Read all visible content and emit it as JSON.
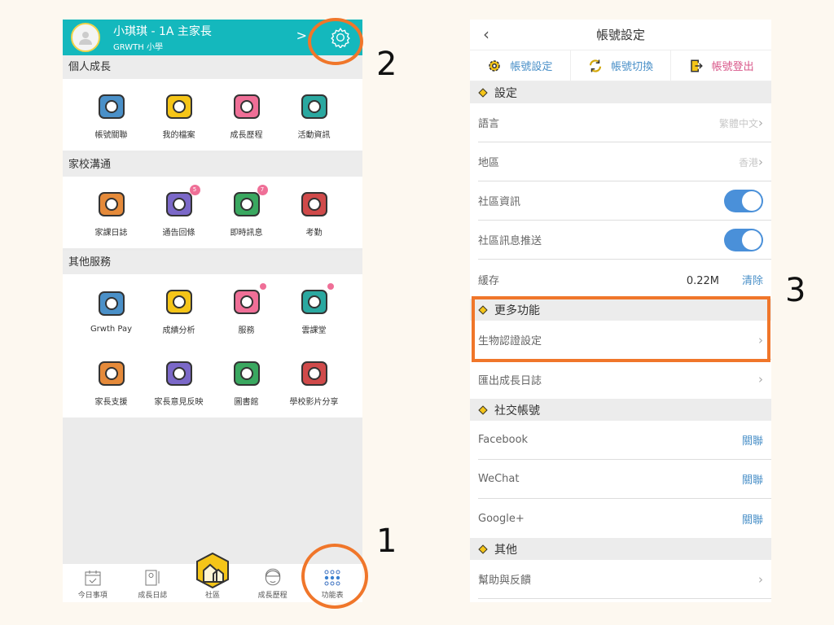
{
  "left": {
    "header": {
      "name": "小琪琪 - 1A  主家長",
      "school": "GRWTH 小學"
    },
    "sections": [
      {
        "title": "個人成長",
        "items": [
          {
            "label": "帳號關聯"
          },
          {
            "label": "我的檔案"
          },
          {
            "label": "成長歷程"
          },
          {
            "label": "活動資訊"
          }
        ]
      },
      {
        "title": "家校溝通",
        "items": [
          {
            "label": "家課日誌"
          },
          {
            "label": "通告回條",
            "badge": "5"
          },
          {
            "label": "即時訊息",
            "badge": "7"
          },
          {
            "label": "考勤"
          }
        ]
      },
      {
        "title": "其他服務",
        "items": [
          {
            "label": "Grwth Pay"
          },
          {
            "label": "成績分析"
          },
          {
            "label": "服務"
          },
          {
            "label": "雲課堂"
          },
          {
            "label": "家長支援"
          },
          {
            "label": "家長意見反映"
          },
          {
            "label": "圖書館"
          },
          {
            "label": "學校影片分享"
          }
        ]
      }
    ],
    "nav": [
      {
        "label": "今日事項"
      },
      {
        "label": "成長日誌"
      },
      {
        "label": "社區"
      },
      {
        "label": "成長歷程"
      },
      {
        "label": "功能表"
      }
    ]
  },
  "right": {
    "title": "帳號設定",
    "tabs": [
      {
        "label": "帳號設定",
        "color": "#4a90c8"
      },
      {
        "label": "帳號切換",
        "color": "#4a90c8"
      },
      {
        "label": "帳號登出",
        "color": "#d9588a"
      }
    ],
    "settings_header": "設定",
    "language": {
      "label": "語言",
      "value": "繁體中文"
    },
    "region": {
      "label": "地區",
      "value": "香港"
    },
    "community_info": {
      "label": "社區資訊",
      "on": true
    },
    "community_push": {
      "label": "社區訊息推送",
      "on": true
    },
    "cache": {
      "label": "緩存",
      "value": "0.22M",
      "action": "清除"
    },
    "more_header": "更多功能",
    "biometric": {
      "label": "生物認證設定"
    },
    "export": {
      "label": "匯出成長日誌"
    },
    "social_header": "社交帳號",
    "social": [
      {
        "label": "Facebook",
        "action": "關聯"
      },
      {
        "label": "WeChat",
        "action": "關聯"
      },
      {
        "label": "Google+",
        "action": "關聯"
      }
    ],
    "other_header": "其他",
    "help": {
      "label": "幫助與反饋"
    }
  },
  "annotations": {
    "one": "1",
    "two": "2",
    "three": "3"
  },
  "colors": {
    "teal": "#14b8bd",
    "highlight": "#f0762a",
    "toggle": "#4a90d9"
  }
}
